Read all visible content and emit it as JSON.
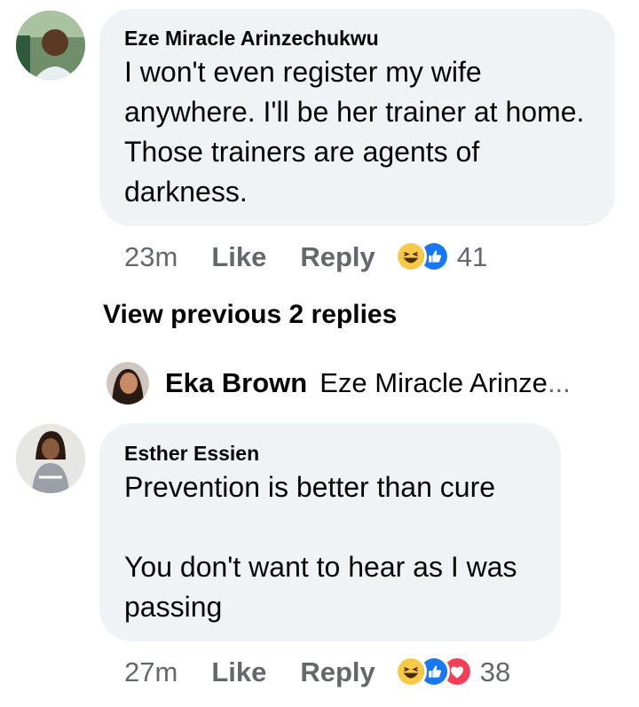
{
  "comments": [
    {
      "author": "Eze Miracle Arinzechukwu",
      "text": "I won't even register my wife anywhere. I'll be her trainer at home. Those trainers are agents of darkness.",
      "time": "23m",
      "like_label": "Like",
      "reply_label": "Reply",
      "reactions": [
        "haha-icon",
        "like-icon"
      ],
      "reaction_count": "41",
      "avatar_icon": "user-avatar-icon"
    },
    {
      "author": "Esther Essien",
      "text": "Prevention is better than cure\n\nYou don't want to hear as I was passing",
      "time": "27m",
      "like_label": "Like",
      "reply_label": "Reply",
      "reactions": [
        "haha-icon",
        "like-icon",
        "love-icon"
      ],
      "reaction_count": "38",
      "avatar_icon": "user-avatar-icon"
    }
  ],
  "thread": {
    "view_previous_label": "View previous 2 replies",
    "reply_preview": {
      "author": "Eka Brown",
      "snippet": "Eze Miracle Arinze",
      "ellipsis": "..."
    }
  },
  "colors": {
    "bubble": "#f0f2f5",
    "meta_text": "#65676b",
    "like_blue": "#1877f2",
    "haha_yellow": "#f7c947",
    "love_red": "#f33e58"
  }
}
